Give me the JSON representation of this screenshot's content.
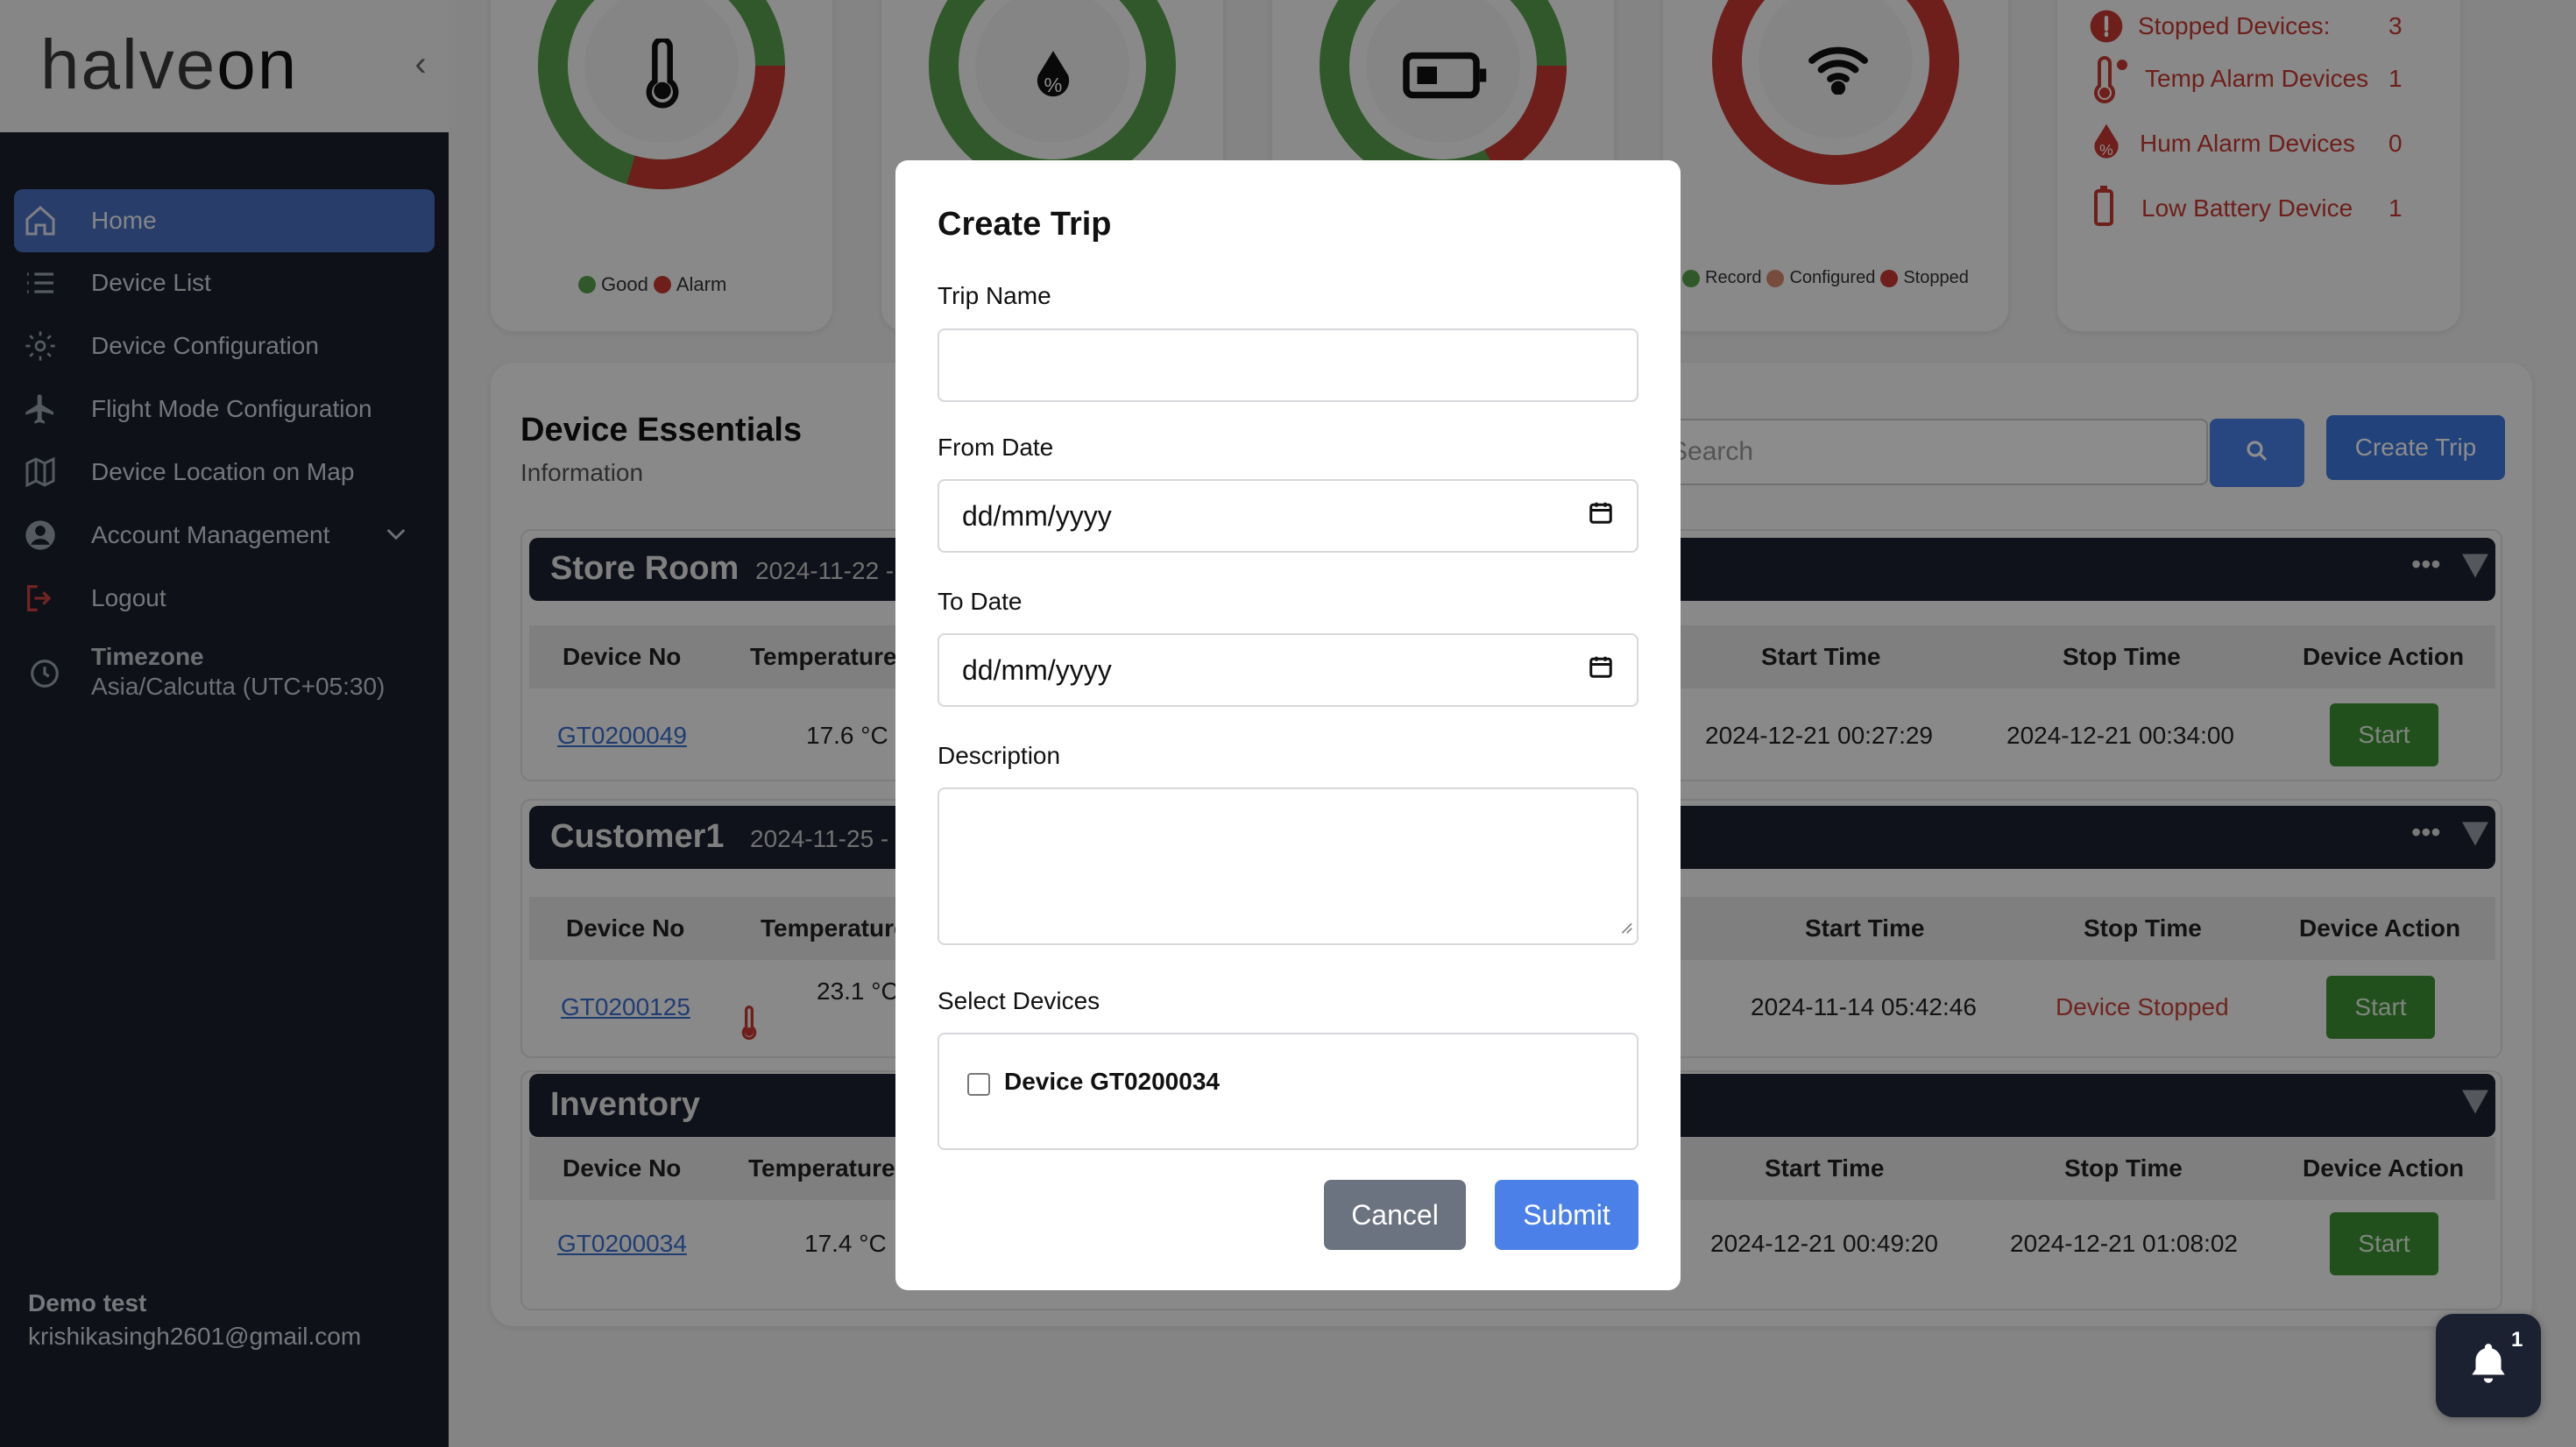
{
  "brand": {
    "name_part1": "halve",
    "name_part2": "on"
  },
  "sidebar": {
    "items": [
      {
        "label": "Home",
        "icon": "home-icon"
      },
      {
        "label": "Device List",
        "icon": "list-icon"
      },
      {
        "label": "Device Configuration",
        "icon": "gear-icon"
      },
      {
        "label": "Flight Mode Configuration",
        "icon": "plane-icon"
      },
      {
        "label": "Device Location on Map",
        "icon": "map-icon"
      },
      {
        "label": "Account Management",
        "icon": "user-icon"
      },
      {
        "label": "Logout",
        "icon": "logout-icon"
      }
    ],
    "timezone_label": "Timezone",
    "timezone_value": "Asia/Calcutta (UTC+05:30)",
    "user_name": "Demo test",
    "user_email": "krishikasingh2601@gmail.com"
  },
  "status_cards": {
    "temperature_legend": [
      "Good",
      "Alarm"
    ],
    "connectivity_legend": [
      "Record",
      "Configured",
      "Stopped"
    ],
    "summary": [
      {
        "label": "Stopped Devices:",
        "value": "3"
      },
      {
        "label": "Temp Alarm Devices",
        "value": "1"
      },
      {
        "label": "Hum Alarm Devices",
        "value": "0"
      },
      {
        "label": "Low Battery Device",
        "value": "1"
      }
    ]
  },
  "essentials": {
    "title": "Device Essentials",
    "subtitle": "Information",
    "search_placeholder": "Search",
    "create_trip_label": "Create Trip",
    "columns": {
      "device_no": "Device No",
      "temperature": "Temperature",
      "start_time": "Start Time",
      "stop_time": "Stop Time",
      "device_action": "Device Action"
    },
    "groups": [
      {
        "name": "Store Room",
        "date": "2024-11-22 -",
        "device": "GT0200049",
        "temperature": "17.6 °C",
        "start": "2024-12-21 00:27:29",
        "stop": "2024-12-21 00:34:00",
        "action": "Start"
      },
      {
        "name": "Customer1",
        "date": "2024-11-25 -",
        "device": "GT0200125",
        "temperature": "23.1 °C",
        "start": "2024-11-14 05:42:46",
        "stop": "Device Stopped",
        "action": "Start"
      },
      {
        "name": "Inventory",
        "date": "",
        "device": "GT0200034",
        "temperature": "17.4 °C",
        "start": "2024-12-21 00:49:20",
        "stop": "2024-12-21 01:08:02",
        "action": "Start"
      }
    ]
  },
  "modal": {
    "title": "Create Trip",
    "trip_name_label": "Trip Name",
    "trip_name_value": "",
    "from_date_label": "From Date",
    "from_date_value": "dd/mm/yyyy",
    "to_date_label": "To Date",
    "to_date_value": "dd/mm/yyyy",
    "description_label": "Description",
    "select_devices_label": "Select Devices",
    "device_option": "Device GT0200034",
    "cancel_label": "Cancel",
    "submit_label": "Submit"
  },
  "notifications": {
    "count": "1"
  },
  "colors": {
    "good": "#5aa04e",
    "alarm": "#c83a32",
    "configured": "#d88a6e",
    "primary": "#4a80e8",
    "sidebar": "#1b1f2d"
  }
}
